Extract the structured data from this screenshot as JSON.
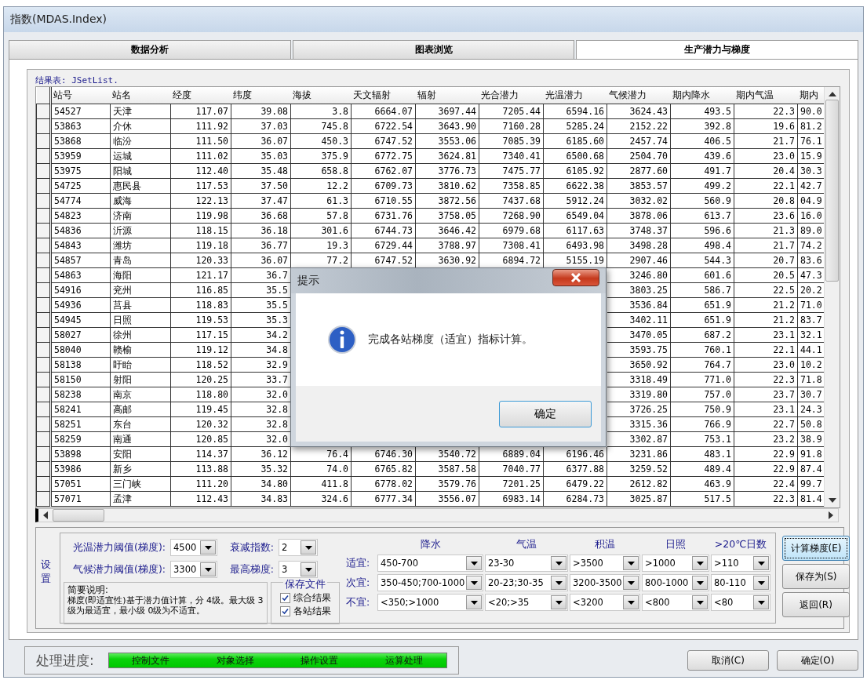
{
  "window": {
    "title": "指数(MDAS.Index)"
  },
  "tabs": [
    {
      "label": "数据分析",
      "selected": false
    },
    {
      "label": "图表浏览",
      "selected": false
    },
    {
      "label": "生产潜力与梯度",
      "selected": true
    }
  ],
  "result_label": "结果表: JSetList.",
  "table": {
    "columns": [
      "站号",
      "站名",
      "经度",
      "纬度",
      "海拔",
      "天文辐射",
      "辐射",
      "光合潜力",
      "光温潜力",
      "气候潜力",
      "期内降水",
      "期内气温",
      "期内"
    ],
    "rows": [
      [
        "54527",
        "天津",
        "117.07",
        "39.08",
        "3.8",
        "6664.07",
        "3697.44",
        "7205.44",
        "6594.16",
        "3624.43",
        "493.5",
        "22.3",
        "90.0"
      ],
      [
        "53863",
        "介休",
        "111.92",
        "37.03",
        "745.8",
        "6722.54",
        "3643.90",
        "7160.28",
        "5285.24",
        "2152.22",
        "392.8",
        "19.6",
        "81.2"
      ],
      [
        "53868",
        "临汾",
        "111.50",
        "36.07",
        "450.3",
        "6747.52",
        "3553.06",
        "7085.39",
        "6185.60",
        "2457.74",
        "406.5",
        "21.7",
        "76.1"
      ],
      [
        "53959",
        "运城",
        "111.02",
        "35.03",
        "375.9",
        "6772.75",
        "3624.81",
        "7340.41",
        "6500.68",
        "2504.70",
        "439.6",
        "23.0",
        "15.9"
      ],
      [
        "53975",
        "阳城",
        "112.40",
        "35.48",
        "658.8",
        "6762.07",
        "3776.73",
        "7475.77",
        "6105.92",
        "2877.60",
        "491.7",
        "20.4",
        "30.3"
      ],
      [
        "54725",
        "惠民县",
        "117.53",
        "37.50",
        "12.2",
        "6709.73",
        "3810.62",
        "7358.85",
        "6622.38",
        "3853.57",
        "499.2",
        "22.1",
        "42.7"
      ],
      [
        "54774",
        "威海",
        "122.13",
        "37.47",
        "61.3",
        "6710.55",
        "3872.56",
        "7437.68",
        "5912.24",
        "3032.02",
        "560.9",
        "20.8",
        "04.9"
      ],
      [
        "54823",
        "济南",
        "119.98",
        "36.68",
        "57.8",
        "6731.76",
        "3758.05",
        "7268.90",
        "6549.04",
        "3878.06",
        "613.7",
        "23.6",
        "16.0"
      ],
      [
        "54836",
        "沂源",
        "118.15",
        "36.18",
        "301.6",
        "6744.73",
        "3646.42",
        "6979.68",
        "6117.63",
        "3748.37",
        "596.6",
        "21.3",
        "89.0"
      ],
      [
        "54843",
        "潍坊",
        "119.18",
        "36.77",
        "19.3",
        "6729.44",
        "3788.97",
        "7308.41",
        "6493.98",
        "3498.28",
        "498.4",
        "21.7",
        "74.2"
      ],
      [
        "54857",
        "青岛",
        "120.33",
        "36.07",
        "77.2",
        "6747.52",
        "3630.92",
        "6894.72",
        "5155.19",
        "2907.46",
        "544.3",
        "20.7",
        "83.6"
      ],
      [
        "54863",
        "海阳",
        "121.17",
        "36.7",
        null,
        null,
        null,
        null,
        null,
        "3246.80",
        "601.6",
        "20.5",
        "47.3"
      ],
      [
        "54916",
        "兖州",
        "116.85",
        "35.5",
        null,
        null,
        null,
        null,
        null,
        "3803.25",
        "586.7",
        "22.5",
        "20.2"
      ],
      [
        "54936",
        "莒县",
        "118.83",
        "35.5",
        null,
        null,
        null,
        null,
        null,
        "3536.84",
        "651.9",
        "21.2",
        "71.0"
      ],
      [
        "54945",
        "日照",
        "119.53",
        "35.3",
        null,
        null,
        null,
        null,
        null,
        "3402.11",
        "651.9",
        "21.2",
        "83.7"
      ],
      [
        "58027",
        "徐州",
        "117.15",
        "34.2",
        null,
        null,
        null,
        null,
        null,
        "3470.05",
        "687.2",
        "23.1",
        "32.1"
      ],
      [
        "58040",
        "赣榆",
        "119.12",
        "34.8",
        null,
        null,
        null,
        null,
        null,
        "3593.75",
        "760.1",
        "22.1",
        "44.1"
      ],
      [
        "58138",
        "盱眙",
        "118.52",
        "32.9",
        null,
        null,
        null,
        null,
        null,
        "3650.92",
        "764.7",
        "23.0",
        "10.2"
      ],
      [
        "58150",
        "射阳",
        "120.25",
        "33.7",
        null,
        null,
        null,
        null,
        null,
        "3318.49",
        "771.0",
        "22.3",
        "71.8"
      ],
      [
        "58238",
        "南京",
        "118.80",
        "32.0",
        null,
        null,
        null,
        null,
        null,
        "3319.80",
        "757.0",
        "23.7",
        "30.7"
      ],
      [
        "58241",
        "高邮",
        "119.45",
        "32.8",
        null,
        null,
        null,
        null,
        null,
        "3726.25",
        "750.9",
        "23.1",
        "24.3"
      ],
      [
        "58251",
        "东台",
        "120.32",
        "32.8",
        null,
        null,
        null,
        null,
        null,
        "3315.36",
        "766.9",
        "22.7",
        "50.8"
      ],
      [
        "58259",
        "南通",
        "120.85",
        "32.0",
        null,
        null,
        null,
        null,
        null,
        "3302.87",
        "753.1",
        "23.2",
        "38.9"
      ],
      [
        "53898",
        "安阳",
        "114.37",
        "36.12",
        "76.4",
        "6746.30",
        "3540.72",
        "6889.04",
        "6196.46",
        "3231.86",
        "483.1",
        "22.9",
        "91.8"
      ],
      [
        "53986",
        "新乡",
        "113.88",
        "35.32",
        "74.0",
        "6765.82",
        "3587.58",
        "7040.77",
        "6377.88",
        "3259.52",
        "489.4",
        "22.9",
        "87.4"
      ],
      [
        "57051",
        "三门峡",
        "111.20",
        "34.80",
        "411.8",
        "6778.02",
        "3579.76",
        "7201.25",
        "6479.22",
        "2612.82",
        "463.9",
        "22.4",
        "99.7"
      ],
      [
        "57071",
        "孟津",
        "112.43",
        "34.83",
        "324.6",
        "6777.34",
        "3556.07",
        "6983.14",
        "6284.73",
        "3025.87",
        "517.5",
        "22.3",
        "81.4"
      ]
    ]
  },
  "dialog": {
    "title": "提示",
    "message": "完成各站梯度（适宜）指标计算。",
    "button": "确定"
  },
  "settings": {
    "title": "设置",
    "thresholds": [
      {
        "label": "光温潜力阈值(梯度):",
        "value": "4500"
      },
      {
        "label": "气候潜力阈值(梯度):",
        "value": "3300"
      }
    ],
    "options": [
      {
        "label": "衰减指数:",
        "value": "2"
      },
      {
        "label": "最高梯度:",
        "value": "3"
      }
    ],
    "note": {
      "title": "简要说明:",
      "text": "梯度(即适宜性)基于潜力值计算，分 4级。最大级 3级为最适宜，最小级 0级为不适宜。"
    },
    "save": {
      "title": "保存文件",
      "items": [
        {
          "label": "综合结果",
          "checked": true
        },
        {
          "label": "各站结果",
          "checked": true
        }
      ]
    },
    "criteria": {
      "columns": [
        "降水",
        "气温",
        "积温",
        "日照",
        ">20℃日数"
      ],
      "rows": [
        {
          "label": "适宜:",
          "values": [
            "450-700",
            "23-30",
            ">3500",
            ">1000",
            ">110"
          ]
        },
        {
          "label": "次宜:",
          "values": [
            "350-450;700-1000",
            "20-23;30-35",
            "3200-3500",
            "800-1000",
            "80-110"
          ]
        },
        {
          "label": "不宜:",
          "values": [
            "<350;>1000",
            "<20;>35",
            "<3200",
            "<800",
            "<80"
          ]
        }
      ]
    }
  },
  "actions": [
    {
      "label": "计算梯度(E)",
      "focused": true
    },
    {
      "label": "保存为(S)",
      "focused": false
    },
    {
      "label": "返回(R)",
      "focused": false
    }
  ],
  "progress": {
    "label": "处理进度:",
    "level": 1,
    "steps": [
      "控制文件",
      "对象选择",
      "操作设置",
      "运算处理"
    ]
  },
  "buttons": [
    "取消(C)",
    "确定(O)"
  ]
}
